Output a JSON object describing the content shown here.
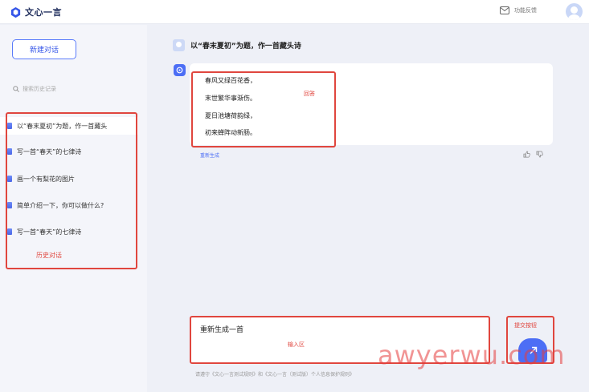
{
  "app": {
    "title": "文心一言"
  },
  "topbar": {
    "feedback_label": "功能反馈"
  },
  "sidebar": {
    "new_chat_label": "新建对话",
    "search_placeholder": "搜索历史记录",
    "history": [
      {
        "label": "以“春末夏初”为题，作一首藏头"
      },
      {
        "label": "写一首“春天”的七律诗"
      },
      {
        "label": "画一个有梨花的图片"
      },
      {
        "label": "简单介绍一下，你可以做什么?"
      },
      {
        "label": "写一首“春天”的七律诗"
      }
    ],
    "history_annotation": "历史对话"
  },
  "conversation": {
    "question": "以“春末夏初”为题，作一首藏头诗",
    "answer_lines": [
      "春风又绿百花香，",
      "末世繁华事渐伤。",
      "夏日池塘荷韵绿，",
      "初来蝉阵动新肠。"
    ],
    "answer_annotation": "回答",
    "regenerate_label": "重新生成"
  },
  "input": {
    "value": "重新生成一首",
    "annotation": "输入区",
    "send_annotation": "提交按钮"
  },
  "footer": {
    "text": "请遵守《文心一言测试规则》和《文心一言（测试版）个人信息保护规则》"
  },
  "watermark": "awyerwu.com",
  "colors": {
    "accent": "#4c6ef5",
    "annotation": "#e0463e",
    "sidebar_bg": "#f4f5fa",
    "main_bg": "#eef0f7"
  }
}
